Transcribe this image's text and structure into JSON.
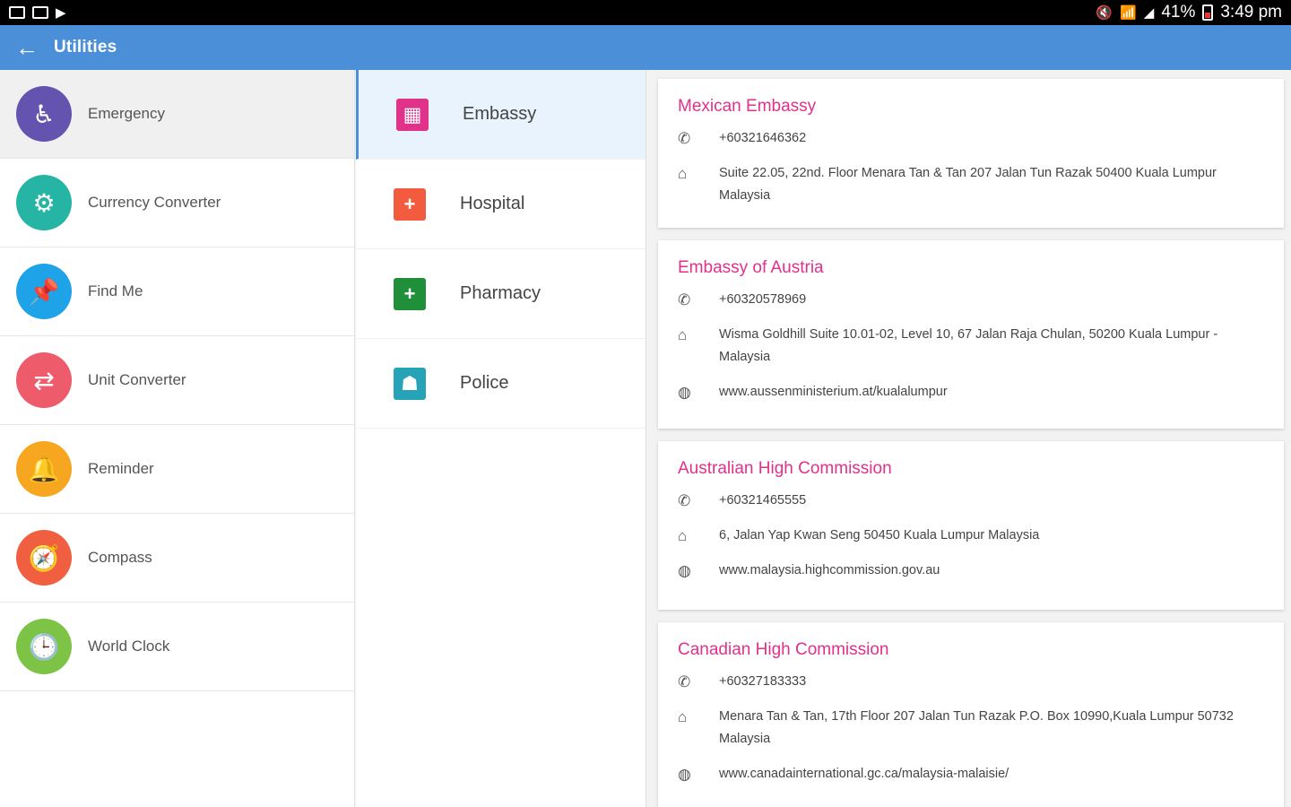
{
  "status_bar": {
    "battery": "41%",
    "time": "3:49 pm"
  },
  "app_bar": {
    "title": "Utilities"
  },
  "utilities": [
    {
      "label": "Emergency",
      "icon": "emergency-icon",
      "color": "#6553b0"
    },
    {
      "label": "Currency Converter",
      "icon": "currency-icon",
      "color": "#26b5a5"
    },
    {
      "label": "Find Me",
      "icon": "pin-icon",
      "color": "#1fa3e8"
    },
    {
      "label": "Unit Converter",
      "icon": "swap-icon",
      "color": "#ee5b6b"
    },
    {
      "label": "Reminder",
      "icon": "bell-icon",
      "color": "#f7a620"
    },
    {
      "label": "Compass",
      "icon": "compass-icon",
      "color": "#f05f40"
    },
    {
      "label": "World Clock",
      "icon": "clock-icon",
      "color": "#7cc346"
    }
  ],
  "categories": [
    {
      "label": "Embassy",
      "icon": "building-icon",
      "color": "#e0318b"
    },
    {
      "label": "Hospital",
      "icon": "hospital-icon",
      "color": "#f35b3e"
    },
    {
      "label": "Pharmacy",
      "icon": "pharmacy-icon",
      "color": "#1f8f3a"
    },
    {
      "label": "Police",
      "icon": "police-icon",
      "color": "#27a3b8"
    }
  ],
  "embassies": [
    {
      "name": "Mexican Embassy",
      "phone": "+60321646362",
      "address": "Suite 22.05, 22nd. Floor Menara Tan & Tan 207 Jalan Tun Razak 50400 Kuala Lumpur Malaysia",
      "website": ""
    },
    {
      "name": "Embassy of Austria",
      "phone": "+60320578969",
      "address": "Wisma Goldhill Suite 10.01-02, Level 10,  67 Jalan Raja Chulan,  50200 Kuala Lumpur - Malaysia",
      "website": "www.aussenministerium.at/kualalumpur"
    },
    {
      "name": "Australian High Commission",
      "phone": "+60321465555",
      "address": "6, Jalan Yap Kwan Seng 50450 Kuala Lumpur Malaysia",
      "website": "www.malaysia.highcommission.gov.au"
    },
    {
      "name": "Canadian High Commission",
      "phone": "+60327183333",
      "address": "Menara Tan & Tan, 17th Floor 207 Jalan Tun Razak P.O. Box 10990,Kuala Lumpur 50732 Malaysia",
      "website": "www.canadainternational.gc.ca/malaysia-malaisie/"
    }
  ]
}
